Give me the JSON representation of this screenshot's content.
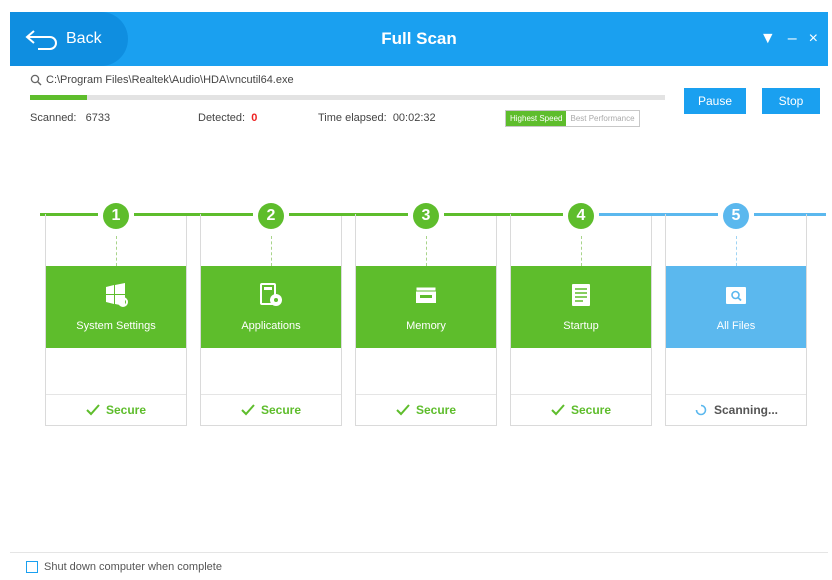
{
  "header": {
    "back_label": "Back",
    "title": "Full Scan",
    "menu_glyph": "▼",
    "minimize_glyph": "–",
    "close_glyph": "×"
  },
  "scan": {
    "current_file": "C:\\Program Files\\Realtek\\Audio\\HDA\\vncutil64.exe",
    "progress": 0.09,
    "scanned_label": "Scanned:",
    "scanned_value": "6733",
    "detected_label": "Detected:",
    "detected_value": "0",
    "elapsed_label": "Time elapsed:",
    "elapsed_value": "00:02:32"
  },
  "speed": {
    "highest": "Highest Speed",
    "best": "Best Performance",
    "selected": "highest"
  },
  "buttons": {
    "pause": "Pause",
    "stop": "Stop"
  },
  "steps": [
    {
      "number": "1",
      "label": "System Settings",
      "status": "Secure",
      "icon": "settings-icon",
      "state": "done"
    },
    {
      "number": "2",
      "label": "Applications",
      "status": "Secure",
      "icon": "applications-icon",
      "state": "done"
    },
    {
      "number": "3",
      "label": "Memory",
      "status": "Secure",
      "icon": "memory-icon",
      "state": "done"
    },
    {
      "number": "4",
      "label": "Startup",
      "status": "Secure",
      "icon": "startup-icon",
      "state": "done"
    },
    {
      "number": "5",
      "label": "All Files",
      "status": "Scanning...",
      "icon": "all-files-icon",
      "state": "active"
    }
  ],
  "footer": {
    "shutdown_label": "Shut down computer when complete",
    "shutdown_checked": false
  },
  "colors": {
    "accent_blue": "#1aa0f0",
    "green": "#5ebd2c",
    "light_blue": "#5bb8ee",
    "red": "#e22222"
  }
}
